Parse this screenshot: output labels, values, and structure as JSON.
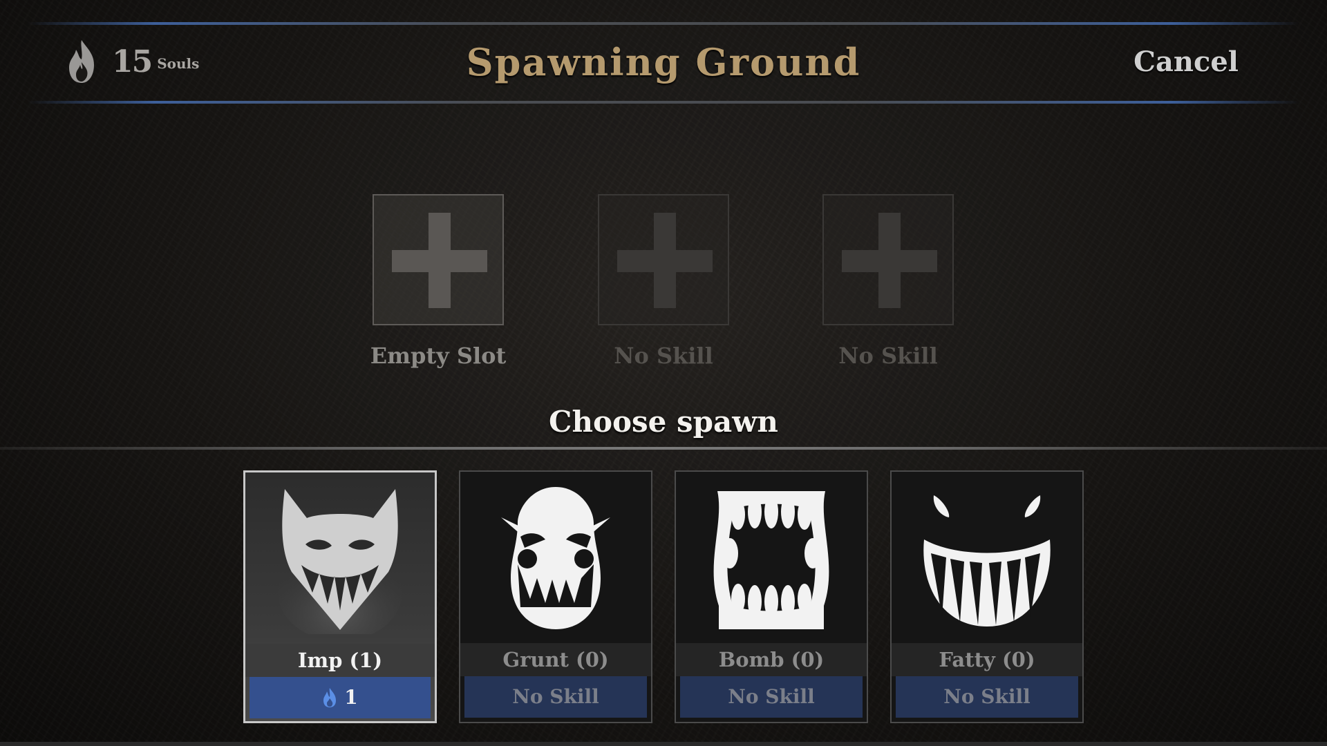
{
  "header": {
    "souls_count": "15",
    "souls_label": "Souls",
    "title": "Spawning Ground",
    "cancel_label": "Cancel"
  },
  "slots": [
    {
      "label": "Empty Slot",
      "state": "active"
    },
    {
      "label": "No Skill",
      "state": "inactive"
    },
    {
      "label": "No Skill",
      "state": "inactive"
    }
  ],
  "section_title": "Choose spawn",
  "spawns": [
    {
      "name": "Imp (1)",
      "skill": "1",
      "skill_icon": "blue-flame-icon",
      "selected": true
    },
    {
      "name": "Grunt (0)",
      "skill": "No Skill",
      "selected": false
    },
    {
      "name": "Bomb (0)",
      "skill": "No Skill",
      "selected": false
    },
    {
      "name": "Fatty (0)",
      "skill": "No Skill",
      "selected": false
    }
  ],
  "colors": {
    "title": "#b59a6e",
    "header_accent": "#3d5f9a",
    "skill_bar": "#253456",
    "skill_bar_selected": "#34508e",
    "skill_flame": "#5b8fe6"
  },
  "icons": [
    "flame-icon",
    "plus-icon",
    "imp-face-icon",
    "grunt-face-icon",
    "bomb-mouth-icon",
    "fatty-grin-icon",
    "blue-flame-icon"
  ]
}
